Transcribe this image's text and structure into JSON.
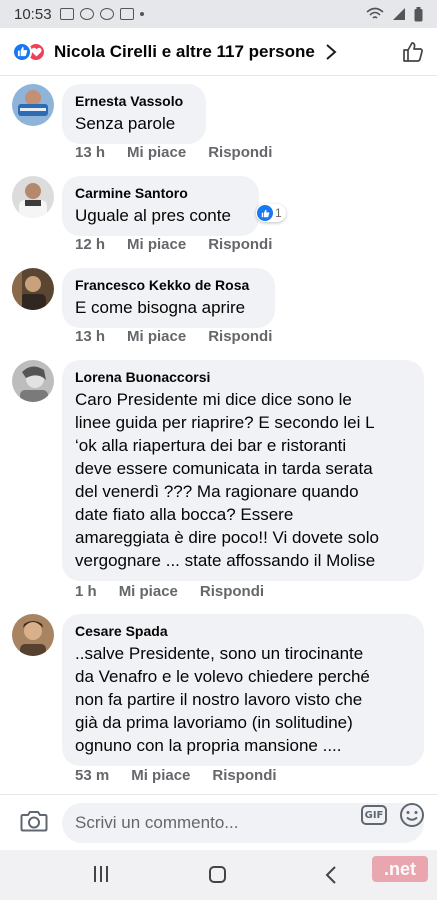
{
  "status_bar": {
    "time": "10:53"
  },
  "header": {
    "title": "Nicola Cirelli e altre 117 persone"
  },
  "action_labels": {
    "like": "Mi piace",
    "reply": "Rispondi"
  },
  "comments": [
    {
      "author": "Ernesta Vassolo",
      "lines": [
        "Senza parole"
      ],
      "time": "13 h"
    },
    {
      "author": "Carmine Santoro",
      "lines": [
        "Uguale al pres conte"
      ],
      "time": "12 h",
      "likes": "1"
    },
    {
      "author": "Francesco Kekko de Rosa",
      "lines": [
        "E come bisogna aprire"
      ],
      "time": "13 h"
    },
    {
      "author": "Lorena Buonaccorsi",
      "lines": [
        "Caro Presidente mi dice dice sono le",
        "linee guida per riaprire? E secondo lei L",
        "‘ok alla riapertura dei bar e ristoranti",
        "deve essere comunicata in tarda serata",
        "del venerdì ??? Ma ragionare quando",
        "date fiato alla bocca? Essere",
        "amareggiata è dire poco!! Vi dovete solo",
        "vergognare ... state affossando il Molise"
      ],
      "time": "1 h"
    },
    {
      "author": "Cesare Spada",
      "lines": [
        "..salve Presidente,  sono un tirocinante",
        "da Venafro e le volevo chiedere perché",
        "non fa partire il nostro lavoro visto che",
        "già da prima lavoriamo (in solitudine)",
        "ognuno con la propria mansione ...."
      ],
      "time": "53 m"
    }
  ],
  "composer": {
    "placeholder": "Scrivi un commento...",
    "gif_label": "GIF"
  },
  "watermark": ".net",
  "colors": {
    "accent": "#1877f2",
    "love": "#f33e58",
    "bubble": "#f0f2f5",
    "muted": "#65676b"
  }
}
